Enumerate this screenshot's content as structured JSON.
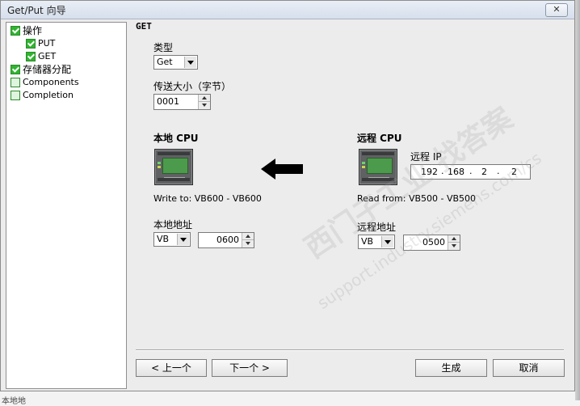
{
  "window": {
    "title": "Get/Put 向导",
    "close_label": "✕"
  },
  "tree": {
    "items": [
      {
        "label": "操作",
        "checked": true
      },
      {
        "label": "PUT",
        "checked": true
      },
      {
        "label": "GET",
        "checked": true
      },
      {
        "label": "存储器分配",
        "checked": true
      },
      {
        "label": "Components",
        "checked": false
      },
      {
        "label": "Completion",
        "checked": false
      }
    ]
  },
  "content": {
    "heading": "GET",
    "type_label": "类型",
    "type_value": "Get",
    "size_label": "传送大小（字节）",
    "size_value": "0001",
    "local": {
      "title": "本地 CPU",
      "write_to": "Write to: VB600 - VB600",
      "addr_label": "本地地址",
      "area_value": "VB",
      "addr_value": "0600"
    },
    "remote": {
      "title": "远程 CPU",
      "ip_label": "远程 IP",
      "ip": [
        "192",
        "168",
        "2",
        "2"
      ],
      "read_from": "Read from: VB500 - VB500",
      "addr_label": "远程地址",
      "area_value": "VB",
      "addr_value": "0500"
    }
  },
  "buttons": {
    "prev": "< 上一个",
    "next": "下一个 >",
    "generate": "生成",
    "cancel": "取消"
  },
  "watermark": {
    "main": "西门子工业 找答案",
    "sub": "support.industry.siemens.com/cs"
  },
  "outside_text": "本地地"
}
